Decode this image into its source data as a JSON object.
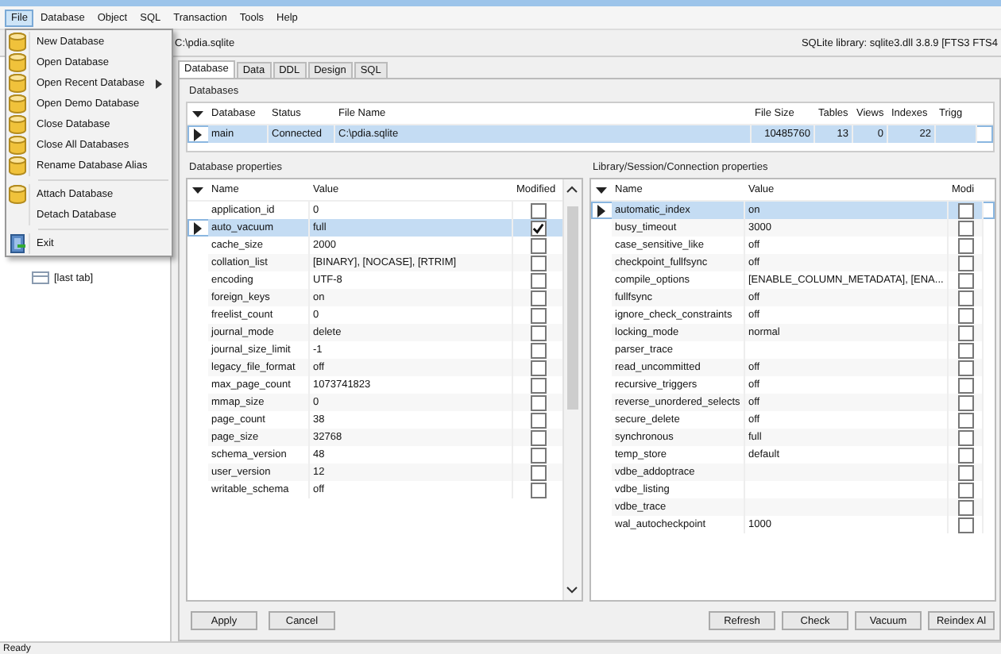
{
  "menu_bar": [
    {
      "label": "File",
      "selected": true
    },
    {
      "label": "Database",
      "selected": false
    },
    {
      "label": "Object",
      "selected": false
    },
    {
      "label": "SQL",
      "selected": false
    },
    {
      "label": "Transaction",
      "selected": false
    },
    {
      "label": "Tools",
      "selected": false
    },
    {
      "label": "Help",
      "selected": false
    }
  ],
  "file_menu": [
    {
      "kind": "database",
      "label": "New Database",
      "submenu": false
    },
    {
      "kind": "database",
      "label": "Open Database",
      "submenu": false
    },
    {
      "kind": "database",
      "label": "Open Recent Database",
      "submenu": true
    },
    {
      "kind": "database",
      "label": "Open Demo Database",
      "submenu": false
    },
    {
      "kind": "database",
      "label": "Close Database",
      "submenu": false
    },
    {
      "kind": "database",
      "label": "Close All Databases",
      "submenu": false
    },
    {
      "kind": "database",
      "label": "Rename Database Alias",
      "submenu": false
    },
    {
      "kind": "separator"
    },
    {
      "kind": "database",
      "label": "Attach Database",
      "submenu": false
    },
    {
      "kind": "plain",
      "label": "Detach Database",
      "submenu": false
    },
    {
      "kind": "separator"
    },
    {
      "kind": "exit",
      "label": "Exit",
      "submenu": false
    }
  ],
  "toolbar": {
    "path": "C:\\pdia.sqlite",
    "library": "SQLite library: sqlite3.dll 3.8.9 [FTS3 FTS4"
  },
  "sidebar": {
    "items": [
      {
        "label": "[last tab]"
      }
    ]
  },
  "tabs": [
    {
      "label": "Database",
      "selected": true
    },
    {
      "label": "Data",
      "selected": false
    },
    {
      "label": "DDL",
      "selected": false
    },
    {
      "label": "Design",
      "selected": false
    },
    {
      "label": "SQL",
      "selected": false
    }
  ],
  "databases": {
    "title": "Databases",
    "columns": [
      "Database",
      "Status",
      "File Name",
      "File Size",
      "Tables",
      "Views",
      "Indexes",
      "Trigg"
    ],
    "rows": [
      {
        "selected": true,
        "cells": [
          "main",
          "Connected",
          "C:\\pdia.sqlite",
          "10485760",
          "13",
          "0",
          "22",
          ""
        ]
      }
    ]
  },
  "database_properties": {
    "title": "Database properties",
    "columns": [
      "Name",
      "Value",
      "Modified"
    ],
    "rows": [
      {
        "name": "application_id",
        "value": "0",
        "modified": false,
        "selected": false
      },
      {
        "name": "auto_vacuum",
        "value": "full",
        "modified": true,
        "selected": true
      },
      {
        "name": "cache_size",
        "value": "2000",
        "modified": false,
        "selected": false
      },
      {
        "name": "collation_list",
        "value": "[BINARY], [NOCASE], [RTRIM]",
        "modified": false,
        "selected": false
      },
      {
        "name": "encoding",
        "value": "UTF-8",
        "modified": false,
        "selected": false
      },
      {
        "name": "foreign_keys",
        "value": "on",
        "modified": false,
        "selected": false
      },
      {
        "name": "freelist_count",
        "value": "0",
        "modified": false,
        "selected": false
      },
      {
        "name": "journal_mode",
        "value": "delete",
        "modified": false,
        "selected": false
      },
      {
        "name": "journal_size_limit",
        "value": "-1",
        "modified": false,
        "selected": false
      },
      {
        "name": "legacy_file_format",
        "value": "off",
        "modified": false,
        "selected": false
      },
      {
        "name": "max_page_count",
        "value": "1073741823",
        "modified": false,
        "selected": false
      },
      {
        "name": "mmap_size",
        "value": "0",
        "modified": false,
        "selected": false
      },
      {
        "name": "page_count",
        "value": "38",
        "modified": false,
        "selected": false
      },
      {
        "name": "page_size",
        "value": "32768",
        "modified": false,
        "selected": false
      },
      {
        "name": "schema_version",
        "value": "48",
        "modified": false,
        "selected": false
      },
      {
        "name": "user_version",
        "value": "12",
        "modified": false,
        "selected": false
      },
      {
        "name": "writable_schema",
        "value": "off",
        "modified": false,
        "selected": false
      }
    ],
    "buttons": [
      "Apply",
      "Cancel"
    ]
  },
  "connection_properties": {
    "title": "Library/Session/Connection properties",
    "columns": [
      "Name",
      "Value",
      "Modi"
    ],
    "rows": [
      {
        "name": "automatic_index",
        "value": "on",
        "modified": false,
        "selected": true
      },
      {
        "name": "busy_timeout",
        "value": "3000",
        "modified": false,
        "selected": false
      },
      {
        "name": "case_sensitive_like",
        "value": "off",
        "modified": false,
        "selected": false
      },
      {
        "name": "checkpoint_fullfsync",
        "value": "off",
        "modified": false,
        "selected": false
      },
      {
        "name": "compile_options",
        "value": "[ENABLE_COLUMN_METADATA], [ENA...",
        "modified": false,
        "selected": false
      },
      {
        "name": "fullfsync",
        "value": "off",
        "modified": false,
        "selected": false
      },
      {
        "name": "ignore_check_constraints",
        "value": "off",
        "modified": false,
        "selected": false
      },
      {
        "name": "locking_mode",
        "value": "normal",
        "modified": false,
        "selected": false
      },
      {
        "name": "parser_trace",
        "value": "",
        "modified": false,
        "selected": false
      },
      {
        "name": "read_uncommitted",
        "value": "off",
        "modified": false,
        "selected": false
      },
      {
        "name": "recursive_triggers",
        "value": "off",
        "modified": false,
        "selected": false
      },
      {
        "name": "reverse_unordered_selects",
        "value": "off",
        "modified": false,
        "selected": false
      },
      {
        "name": "secure_delete",
        "value": "off",
        "modified": false,
        "selected": false
      },
      {
        "name": "synchronous",
        "value": "full",
        "modified": false,
        "selected": false
      },
      {
        "name": "temp_store",
        "value": "default",
        "modified": false,
        "selected": false
      },
      {
        "name": "vdbe_addoptrace",
        "value": "",
        "modified": false,
        "selected": false
      },
      {
        "name": "vdbe_listing",
        "value": "",
        "modified": false,
        "selected": false
      },
      {
        "name": "vdbe_trace",
        "value": "",
        "modified": false,
        "selected": false
      },
      {
        "name": "wal_autocheckpoint",
        "value": "1000",
        "modified": false,
        "selected": false
      }
    ],
    "buttons": [
      "Refresh",
      "Check",
      "Vacuum",
      "Reindex Al"
    ]
  },
  "status_bar": "Ready"
}
